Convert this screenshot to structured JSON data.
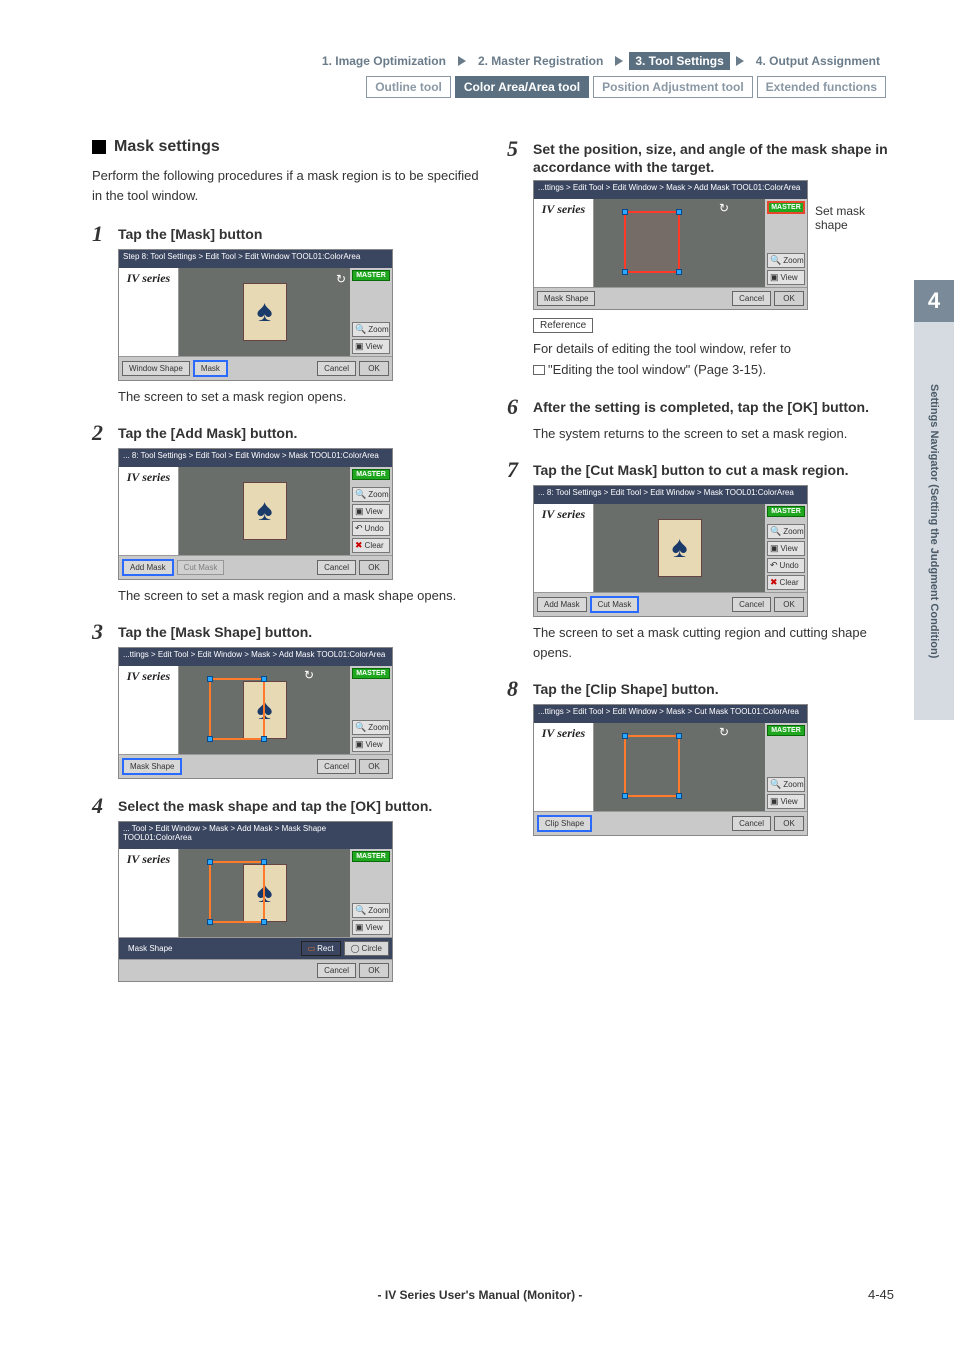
{
  "header": {
    "crumbs": [
      "1. Image Optimization",
      "2. Master Registration",
      "3. Tool Settings",
      "4. Output Assignment"
    ],
    "active_crumb": 2,
    "tabs": [
      "Outline tool",
      "Color Area/Area tool",
      "Position Adjustment tool",
      "Extended functions"
    ],
    "active_tab": 1
  },
  "section_title": "Mask settings",
  "intro": "Perform the following procedures if a mask region is to be specified in the tool window.",
  "steps": {
    "s1": {
      "num": "1",
      "title": "Tap the [Mask] button",
      "desc": "The screen to set a mask region opens.",
      "dev": {
        "crumb": "Step 8: Tool Settings > Edit Tool > Edit Window\nTOOL01:ColorArea",
        "brand": "IV series",
        "right": [
          "MASTER",
          "Zoom",
          "View"
        ],
        "bottom": [
          "Window Shape",
          "Mask",
          "",
          "Cancel",
          "OK"
        ],
        "highlight_bottom": 1
      }
    },
    "s2": {
      "num": "2",
      "title": "Tap the [Add Mask] button.",
      "desc": "The screen to set a mask region and a mask shape opens.",
      "dev": {
        "crumb": "... 8: Tool Settings > Edit Tool > Edit Window > Mask\nTOOL01:ColorArea",
        "brand": "IV series",
        "right": [
          "MASTER",
          "Zoom",
          "View",
          "Undo",
          "Clear"
        ],
        "bottom": [
          "Add Mask",
          "Cut Mask",
          "",
          "Cancel",
          "OK"
        ],
        "highlight_bottom": 0
      }
    },
    "s3": {
      "num": "3",
      "title": "Tap the [Mask Shape] button.",
      "dev": {
        "crumb": "...ttings > Edit Tool > Edit Window > Mask > Add Mask\nTOOL01:ColorArea",
        "brand": "IV series",
        "right": [
          "MASTER",
          "Zoom",
          "View"
        ],
        "bottom": [
          "Mask Shape",
          "",
          "",
          "Cancel",
          "OK"
        ],
        "highlight_bottom": 0,
        "show_rect": true
      }
    },
    "s4": {
      "num": "4",
      "title": "Select the mask shape and tap the [OK] button.",
      "dev": {
        "crumb": "... Tool > Edit Window > Mask > Add Mask > Mask Shape\nTOOL01:ColorArea",
        "brand": "IV series",
        "right": [
          "MASTER",
          "Zoom",
          "View"
        ],
        "bottom_row1_label": "Mask Shape",
        "bottom_row1": [
          "Rect",
          "Circle"
        ],
        "bottom": [
          "",
          "",
          "",
          "Cancel",
          "OK"
        ],
        "show_rect": true
      }
    },
    "s5": {
      "num": "5",
      "title": "Set the position, size, and angle of the mask shape in accordance with the target.",
      "annot": "Set mask shape",
      "dev": {
        "crumb": "...ttings > Edit Tool > Edit Window > Mask > Add Mask\nTOOL01:ColorArea",
        "brand": "IV series",
        "right": [
          "MASTER",
          "Zoom",
          "View"
        ],
        "bottom": [
          "Mask Shape",
          "",
          "",
          "Cancel",
          "OK"
        ],
        "show_rect": true
      },
      "reference_label": "Reference",
      "reference_text": "For details of editing the tool window, refer to",
      "reference_link": "\"Editing the tool window\" (Page 3-15)."
    },
    "s6": {
      "num": "6",
      "title": "After the setting is completed, tap the [OK] button.",
      "desc": "The system returns to the screen to set a mask region."
    },
    "s7": {
      "num": "7",
      "title": "Tap the [Cut Mask] button to cut a mask region.",
      "desc": "The screen to set a mask cutting region and cutting shape opens.",
      "dev": {
        "crumb": "... 8: Tool Settings > Edit Tool > Edit Window > Mask\nTOOL01:ColorArea",
        "brand": "IV series",
        "right": [
          "MASTER",
          "Zoom",
          "View",
          "Undo",
          "Clear"
        ],
        "bottom": [
          "Add Mask",
          "Cut Mask",
          "",
          "Cancel",
          "OK"
        ],
        "highlight_bottom": 1
      }
    },
    "s8": {
      "num": "8",
      "title": "Tap the [Clip Shape] button.",
      "dev": {
        "crumb": "...ttings > Edit Tool > Edit Window > Mask > Cut Mask\nTOOL01:ColorArea",
        "brand": "IV series",
        "right": [
          "MASTER",
          "Zoom",
          "View"
        ],
        "bottom": [
          "Clip Shape",
          "",
          "",
          "Cancel",
          "OK"
        ],
        "highlight_bottom": 0,
        "show_rect": true
      }
    }
  },
  "side_tab": {
    "num": "4",
    "label": "Settings Navigator (Setting the Judgment Condition)"
  },
  "footer": {
    "center": "- IV Series User's Manual (Monitor) -",
    "page": "4-45"
  }
}
